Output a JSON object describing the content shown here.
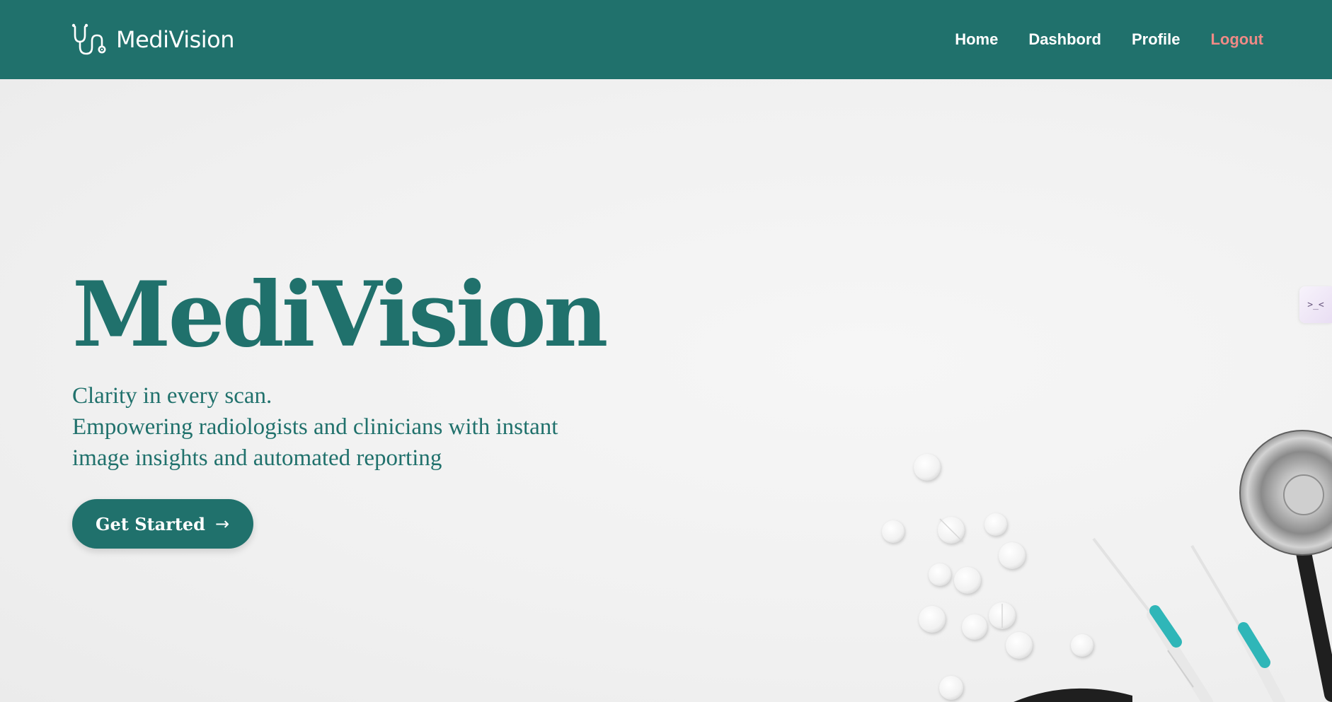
{
  "brand": {
    "name": "MediVision",
    "icon": "stethoscope-icon"
  },
  "nav": {
    "items": [
      {
        "label": "Home"
      },
      {
        "label": "Dashbord"
      },
      {
        "label": "Profile"
      },
      {
        "label": "Logout"
      }
    ]
  },
  "hero": {
    "title": "MediVision",
    "tagline": "Clarity in every scan.",
    "description_line1": "Empowering radiologists and clinicians with instant",
    "description_line2": "image insights and automated reporting",
    "cta_label": "Get Started",
    "cta_icon": "arrow-right-icon"
  },
  "side_widget": {
    "label": ">_<"
  },
  "colors": {
    "primary": "#20716c",
    "logout": "#f08a86",
    "background": "#f2f2f2",
    "syringe_accent": "#2fb6b8"
  }
}
